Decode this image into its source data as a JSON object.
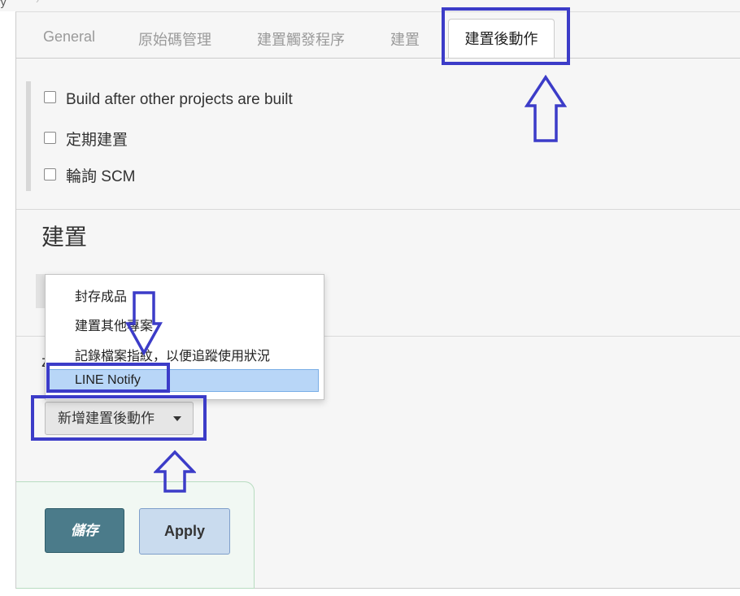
{
  "breadcrumb": {
    "fragment": "ry",
    "separator": "›"
  },
  "tabs": [
    {
      "label": "General"
    },
    {
      "label": "原始碼管理"
    },
    {
      "label": "建置觸發程序"
    },
    {
      "label": "建置"
    },
    {
      "label": "建置後動作",
      "active": true
    }
  ],
  "triggers": {
    "options": [
      {
        "label": "Build after other projects are built",
        "checked": false
      },
      {
        "label": "定期建置",
        "checked": false
      },
      {
        "label": "輪詢 SCM",
        "checked": false
      }
    ]
  },
  "build_section": {
    "title": "建置"
  },
  "post_build": {
    "partial_label": "z",
    "add_button_label": "新增建置後動作",
    "dropdown_options": [
      {
        "label": "封存成品"
      },
      {
        "label": "建置其他專案"
      },
      {
        "label": "記錄檔案指紋，以便追蹤使用狀況"
      },
      {
        "label": "LINE Notify",
        "highlighted": true
      }
    ]
  },
  "actions": {
    "save_label": "儲存",
    "apply_label": "Apply"
  },
  "colors": {
    "annotation": "#3c3cc8",
    "save_button": "#4b7b8a",
    "apply_button": "#c9dbee",
    "selected_item": "#b8d6f7"
  }
}
